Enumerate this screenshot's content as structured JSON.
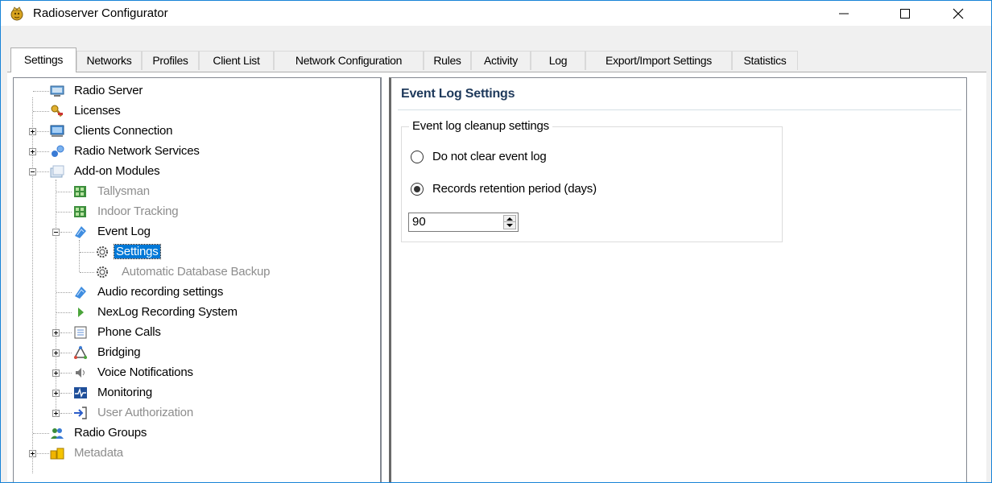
{
  "window": {
    "title": "Radioserver Configurator"
  },
  "tabs": [
    {
      "label": "Settings",
      "active": true
    },
    {
      "label": "Networks"
    },
    {
      "label": "Profiles"
    },
    {
      "label": "Client List"
    },
    {
      "label": "Network Configuration"
    },
    {
      "label": "Rules"
    },
    {
      "label": "Activity"
    },
    {
      "label": "Log"
    },
    {
      "label": "Export/Import Settings"
    },
    {
      "label": "Statistics"
    }
  ],
  "tree": [
    {
      "label": "Radio Server",
      "icon": "server-icon"
    },
    {
      "label": "Licenses",
      "icon": "key-icon"
    },
    {
      "label": "Clients Connection",
      "icon": "network-icon"
    },
    {
      "label": "Radio Network Services",
      "icon": "services-icon"
    },
    {
      "label": "Add-on Modules",
      "icon": "modules-icon"
    },
    {
      "label": "Tallysman",
      "icon": "grid-icon",
      "disabled": true
    },
    {
      "label": "Indoor Tracking",
      "icon": "grid-icon",
      "disabled": true
    },
    {
      "label": "Event Log",
      "icon": "log-icon"
    },
    {
      "label": "Settings",
      "icon": "gear-icon",
      "selected": true
    },
    {
      "label": "Automatic Database Backup",
      "icon": "gear-icon",
      "disabled": true
    },
    {
      "label": "Audio recording settings",
      "icon": "audio-icon"
    },
    {
      "label": "NexLog Recording System",
      "icon": "play-icon"
    },
    {
      "label": "Phone Calls",
      "icon": "phone-icon"
    },
    {
      "label": "Bridging",
      "icon": "bridge-icon"
    },
    {
      "label": "Voice Notifications",
      "icon": "speaker-icon"
    },
    {
      "label": "Monitoring",
      "icon": "monitor-icon"
    },
    {
      "label": "User Authorization",
      "icon": "login-icon",
      "disabled": true
    },
    {
      "label": "Radio Groups",
      "icon": "group-icon"
    },
    {
      "label": "Metadata",
      "icon": "database-icon",
      "disabled": true
    }
  ],
  "panel": {
    "title": "Event Log Settings",
    "group_title": "Event log cleanup settings",
    "option_1": "Do not clear event log",
    "option_2": "Records retention period (days)",
    "selected_option": "Records retention period (days)",
    "retention_days": "90"
  },
  "colors": {
    "accent": "#0078d7",
    "panel_title": "#1e395b"
  }
}
